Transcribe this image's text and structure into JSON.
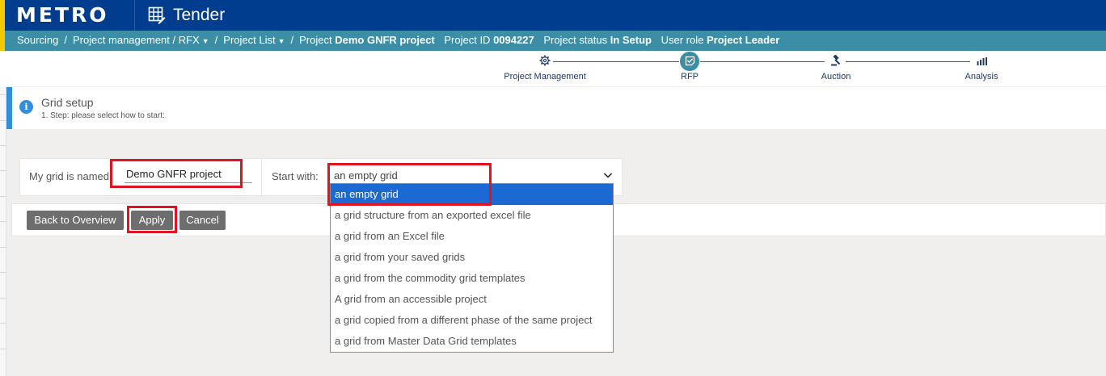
{
  "header": {
    "logo": "METRO",
    "app_title": "Tender",
    "icon": "grid-edit-icon"
  },
  "breadcrumb": {
    "items": [
      "Sourcing",
      "Project management / RFX",
      "Project List"
    ],
    "project_label": "Project",
    "project_name": "Demo GNFR project",
    "project_id_label": "Project ID",
    "project_id": "0094227",
    "status_label": "Project status",
    "status": "In Setup",
    "role_label": "User role",
    "role": "Project Leader"
  },
  "stepper": {
    "steps": [
      {
        "label": "Project Management",
        "icon": "gear-icon"
      },
      {
        "label": "RFP",
        "icon": "document-check-icon",
        "active": true
      },
      {
        "label": "Auction",
        "icon": "gavel-icon"
      },
      {
        "label": "Analysis",
        "icon": "bar-chart-icon"
      }
    ]
  },
  "info": {
    "title": "Grid setup",
    "subtitle": "1. Step: please select how to start:"
  },
  "form": {
    "name_label": "My grid is named:",
    "name_value": "Demo GNFR project",
    "start_label": "Start with:",
    "start_value": "an empty grid"
  },
  "buttons": {
    "back": "Back to Overview",
    "apply": "Apply",
    "cancel": "Cancel"
  },
  "dropdown": {
    "options": [
      "an empty grid",
      "a grid structure from an exported excel file",
      "a grid from an Excel file",
      "a grid from your saved grids",
      "a grid from the commodity grid templates",
      "A grid from an accessible project",
      "a grid copied from a different phase of the same project",
      "a grid from Master Data Grid templates"
    ],
    "selected_index": 0
  },
  "colors": {
    "brand_blue": "#003d8f",
    "brand_yellow": "#f5c800",
    "teal": "#3b8ea5",
    "highlight_red": "#e0141e",
    "selected_blue": "#1b6ad4"
  }
}
